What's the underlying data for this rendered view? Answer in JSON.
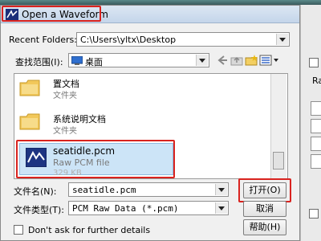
{
  "window": {
    "title": "Open a Waveform"
  },
  "recent": {
    "label": "Recent Folders:",
    "value": "C:\\Users\\yltx\\Desktop"
  },
  "lookin": {
    "label": "查找范围(I):",
    "value": "桌面"
  },
  "files": [
    {
      "name": "置文档",
      "type": "文件夹"
    },
    {
      "name": "系统说明文档",
      "type": "文件夹"
    },
    {
      "name": "seatidle.pcm",
      "type": "Raw PCM file",
      "size": "329 KB"
    }
  ],
  "filename": {
    "label": "文件名(N):",
    "value": "seatidle.pcm"
  },
  "filetype": {
    "label": "文件类型(T):",
    "value": "PCM Raw Data (*.pcm)"
  },
  "buttons": {
    "open": "打开(O)",
    "cancel": "取消",
    "help": "帮助(H)"
  },
  "checkbox": {
    "label": "Don't ask for further details"
  },
  "side": {
    "text": "Raw"
  },
  "colors": {
    "highlight_red": "#d9231f",
    "selection": "#cce4f7"
  }
}
